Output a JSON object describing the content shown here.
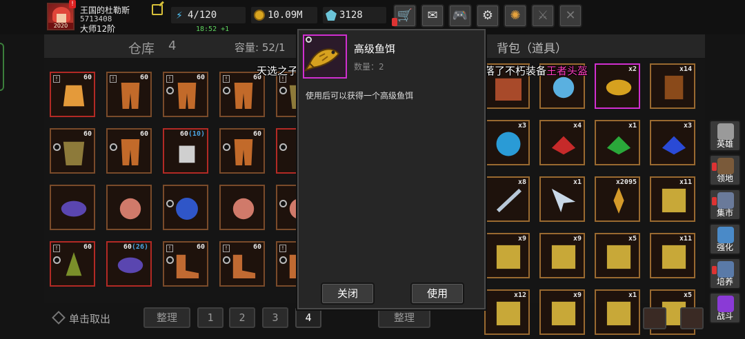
{
  "player": {
    "name": "王国的杜勒斯",
    "id": "5713408",
    "rank": "大师12阶",
    "avatar_badge": "2020"
  },
  "resources": {
    "energy": "4/120",
    "energy_timer": "18:52 +1",
    "gold": "10.09M",
    "gems": "3128"
  },
  "top_buttons": [
    "cart-icon",
    "mail-icon",
    "gamepad-icon",
    "gear-icon",
    "pinwheel-icon",
    "sword-icon",
    "crossed-swords-icon"
  ],
  "warehouse": {
    "title": "仓库",
    "page": "4",
    "capacity": "容量: 52/1",
    "unload_label": "单击取出",
    "sort_label": "整理",
    "pages": [
      "1",
      "2",
      "3",
      "4"
    ],
    "active_page": "4",
    "slots": [
      {
        "n": "60",
        "extra": "",
        "item": "gauntlet",
        "border": "red",
        "marker": "excl"
      },
      {
        "n": "60",
        "extra": "",
        "item": "greaves",
        "border": "brown",
        "marker": "excl"
      },
      {
        "n": "60",
        "extra": "",
        "item": "greaves",
        "border": "brown",
        "marker": "both"
      },
      {
        "n": "60",
        "extra": "",
        "item": "greaves",
        "border": "brown",
        "marker": "both"
      },
      {
        "n": "60",
        "extra": "",
        "item": "armor",
        "border": "brown",
        "marker": "both"
      },
      {
        "n": "60",
        "extra": "",
        "item": "armor",
        "border": "brown",
        "marker": "circ"
      },
      {
        "n": "60",
        "extra": "",
        "item": "greaves",
        "border": "brown",
        "marker": "circ"
      },
      {
        "n": "60",
        "extra": "10",
        "item": "locked",
        "border": "red",
        "marker": "none"
      },
      {
        "n": "60",
        "extra": "",
        "item": "greaves",
        "border": "brown",
        "marker": "circ"
      },
      {
        "n": "",
        "extra": "",
        "item": "axe",
        "border": "red",
        "marker": "circ"
      },
      {
        "n": "",
        "extra": "",
        "item": "bracelet",
        "border": "brown",
        "marker": "none"
      },
      {
        "n": "",
        "extra": "",
        "item": "ring",
        "border": "brown",
        "marker": "none"
      },
      {
        "n": "",
        "extra": "",
        "item": "amulet",
        "border": "brown",
        "marker": "circ"
      },
      {
        "n": "",
        "extra": "",
        "item": "ring",
        "border": "brown",
        "marker": "none"
      },
      {
        "n": "",
        "extra": "",
        "item": "ring",
        "border": "brown",
        "marker": "circ"
      },
      {
        "n": "60",
        "extra": "",
        "item": "helm",
        "border": "red",
        "marker": "both"
      },
      {
        "n": "60",
        "extra": "26",
        "item": "bracelet",
        "border": "red",
        "marker": "none"
      },
      {
        "n": "60",
        "extra": "",
        "item": "boots",
        "border": "brown",
        "marker": "both"
      },
      {
        "n": "60",
        "extra": "",
        "item": "boots",
        "border": "brown",
        "marker": "both"
      },
      {
        "n": "",
        "extra": "",
        "item": "boots",
        "border": "brown",
        "marker": "both"
      }
    ]
  },
  "backpack": {
    "title": "背包（道具）",
    "sort_label": "整理",
    "slots": [
      {
        "n": "",
        "item": "chest"
      },
      {
        "n": "",
        "item": "scissors"
      },
      {
        "n": "x2",
        "item": "fish",
        "border": "magenta"
      },
      {
        "n": "x14",
        "item": "book"
      },
      {
        "n": "x3",
        "item": "orb"
      },
      {
        "n": "x4",
        "item": "red-gem"
      },
      {
        "n": "x1",
        "item": "green-gem"
      },
      {
        "n": "x3",
        "item": "blue-gem"
      },
      {
        "n": "x8",
        "item": "feather"
      },
      {
        "n": "x1",
        "item": "arrowhead"
      },
      {
        "n": "x2095",
        "item": "shard"
      },
      {
        "n": "x11",
        "item": "scroll"
      },
      {
        "n": "x9",
        "item": "scroll"
      },
      {
        "n": "x9",
        "item": "scroll"
      },
      {
        "n": "x5",
        "item": "scroll"
      },
      {
        "n": "x11",
        "item": "scroll"
      },
      {
        "n": "x12",
        "item": "scroll"
      },
      {
        "n": "x9",
        "item": "scroll"
      },
      {
        "n": "x1",
        "item": "scroll"
      },
      {
        "n": "x5",
        "item": "scroll"
      }
    ]
  },
  "side_nav": [
    {
      "label": "英雄",
      "icon": "helmet-icon"
    },
    {
      "label": "领地",
      "icon": "castle-icon"
    },
    {
      "label": "集市",
      "icon": "market-icon"
    },
    {
      "label": "强化",
      "icon": "anvil-icon"
    },
    {
      "label": "培养",
      "icon": "flask-icon"
    },
    {
      "label": "战斗",
      "icon": "portal-icon"
    }
  ],
  "dialog": {
    "item_name": "高级鱼饵",
    "qty_label": "数量：2",
    "description": "使用后可以获得一个高级鱼饵",
    "close_label": "关闭",
    "use_label": "使用"
  },
  "broadcast": {
    "text": "天选之子，玩家咸咸鱼，在无尽深渊中击杀怪物掉落了不朽装备",
    "highlight": "王者头盔"
  },
  "colors": {
    "slot_border_brown": "#7a4b2a",
    "slot_border_red": "#b32a25",
    "slot_border_magenta": "#d12fd1",
    "broadcast_highlight": "#ff3fbf",
    "timer_green": "#5ed45e"
  }
}
